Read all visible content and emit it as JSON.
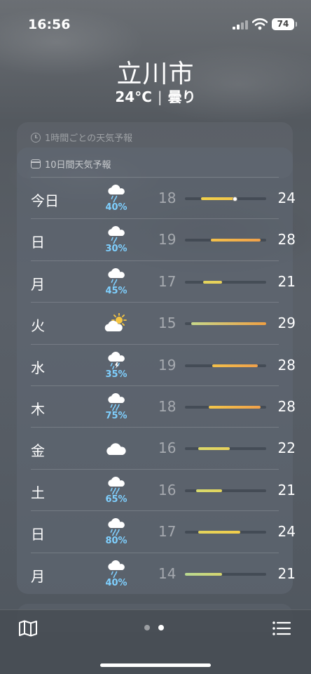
{
  "status": {
    "time": "16:56",
    "battery": "74"
  },
  "location": {
    "city": "立川市",
    "temperature": "24°C",
    "condition": "曇り"
  },
  "hourly_card": {
    "title": "1時間ごとの天気予報",
    "icon": "clock-icon"
  },
  "daily_card": {
    "title": "10日間天気予報",
    "icon": "calendar-icon",
    "days": [
      {
        "day": "今日",
        "icon": "cloud-rain",
        "precip": "40%",
        "low": "18",
        "high": "24",
        "bar_from": 0.2,
        "bar_to": 0.62,
        "colors": [
          "#f2d14a",
          "#f2c54a"
        ],
        "current": 0.62
      },
      {
        "day": "日",
        "icon": "cloud-rain",
        "precip": "30%",
        "low": "19",
        "high": "28",
        "bar_from": 0.32,
        "bar_to": 0.93,
        "colors": [
          "#f2c04a",
          "#f0a04a"
        ]
      },
      {
        "day": "月",
        "icon": "cloud-rain",
        "precip": "45%",
        "low": "17",
        "high": "21",
        "bar_from": 0.22,
        "bar_to": 0.46,
        "colors": [
          "#e3d45c",
          "#e8d05a"
        ]
      },
      {
        "day": "火",
        "icon": "sun-cloud",
        "precip": "",
        "low": "15",
        "high": "29",
        "bar_from": 0.08,
        "bar_to": 1.0,
        "colors": [
          "#c8d88a",
          "#f0a043"
        ]
      },
      {
        "day": "水",
        "icon": "cloud-bolt-rain",
        "precip": "35%",
        "low": "19",
        "high": "28",
        "bar_from": 0.34,
        "bar_to": 0.9,
        "colors": [
          "#f2c04a",
          "#f0a04a"
        ]
      },
      {
        "day": "木",
        "icon": "cloud-heavy-rain",
        "precip": "75%",
        "low": "18",
        "high": "28",
        "bar_from": 0.29,
        "bar_to": 0.93,
        "colors": [
          "#f2c64a",
          "#f0a04a"
        ]
      },
      {
        "day": "金",
        "icon": "cloud",
        "precip": "",
        "low": "16",
        "high": "22",
        "bar_from": 0.16,
        "bar_to": 0.55,
        "colors": [
          "#dcd96a",
          "#e8d25a"
        ]
      },
      {
        "day": "土",
        "icon": "cloud-heavy-rain",
        "precip": "65%",
        "low": "16",
        "high": "21",
        "bar_from": 0.14,
        "bar_to": 0.46,
        "colors": [
          "#d6da6e",
          "#e2d45c"
        ]
      },
      {
        "day": "日",
        "icon": "cloud-heavy-rain",
        "precip": "80%",
        "low": "17",
        "high": "24",
        "bar_from": 0.16,
        "bar_to": 0.68,
        "colors": [
          "#e3d45c",
          "#f2cd4a"
        ]
      },
      {
        "day": "月",
        "icon": "cloud-rain",
        "precip": "40%",
        "low": "14",
        "high": "21",
        "bar_from": 0.0,
        "bar_to": 0.46,
        "colors": [
          "#b9d992",
          "#d6d66e"
        ]
      }
    ]
  },
  "toolbar": {
    "map": "map-icon",
    "list": "list-icon",
    "pages": 2,
    "active_page": 2
  }
}
